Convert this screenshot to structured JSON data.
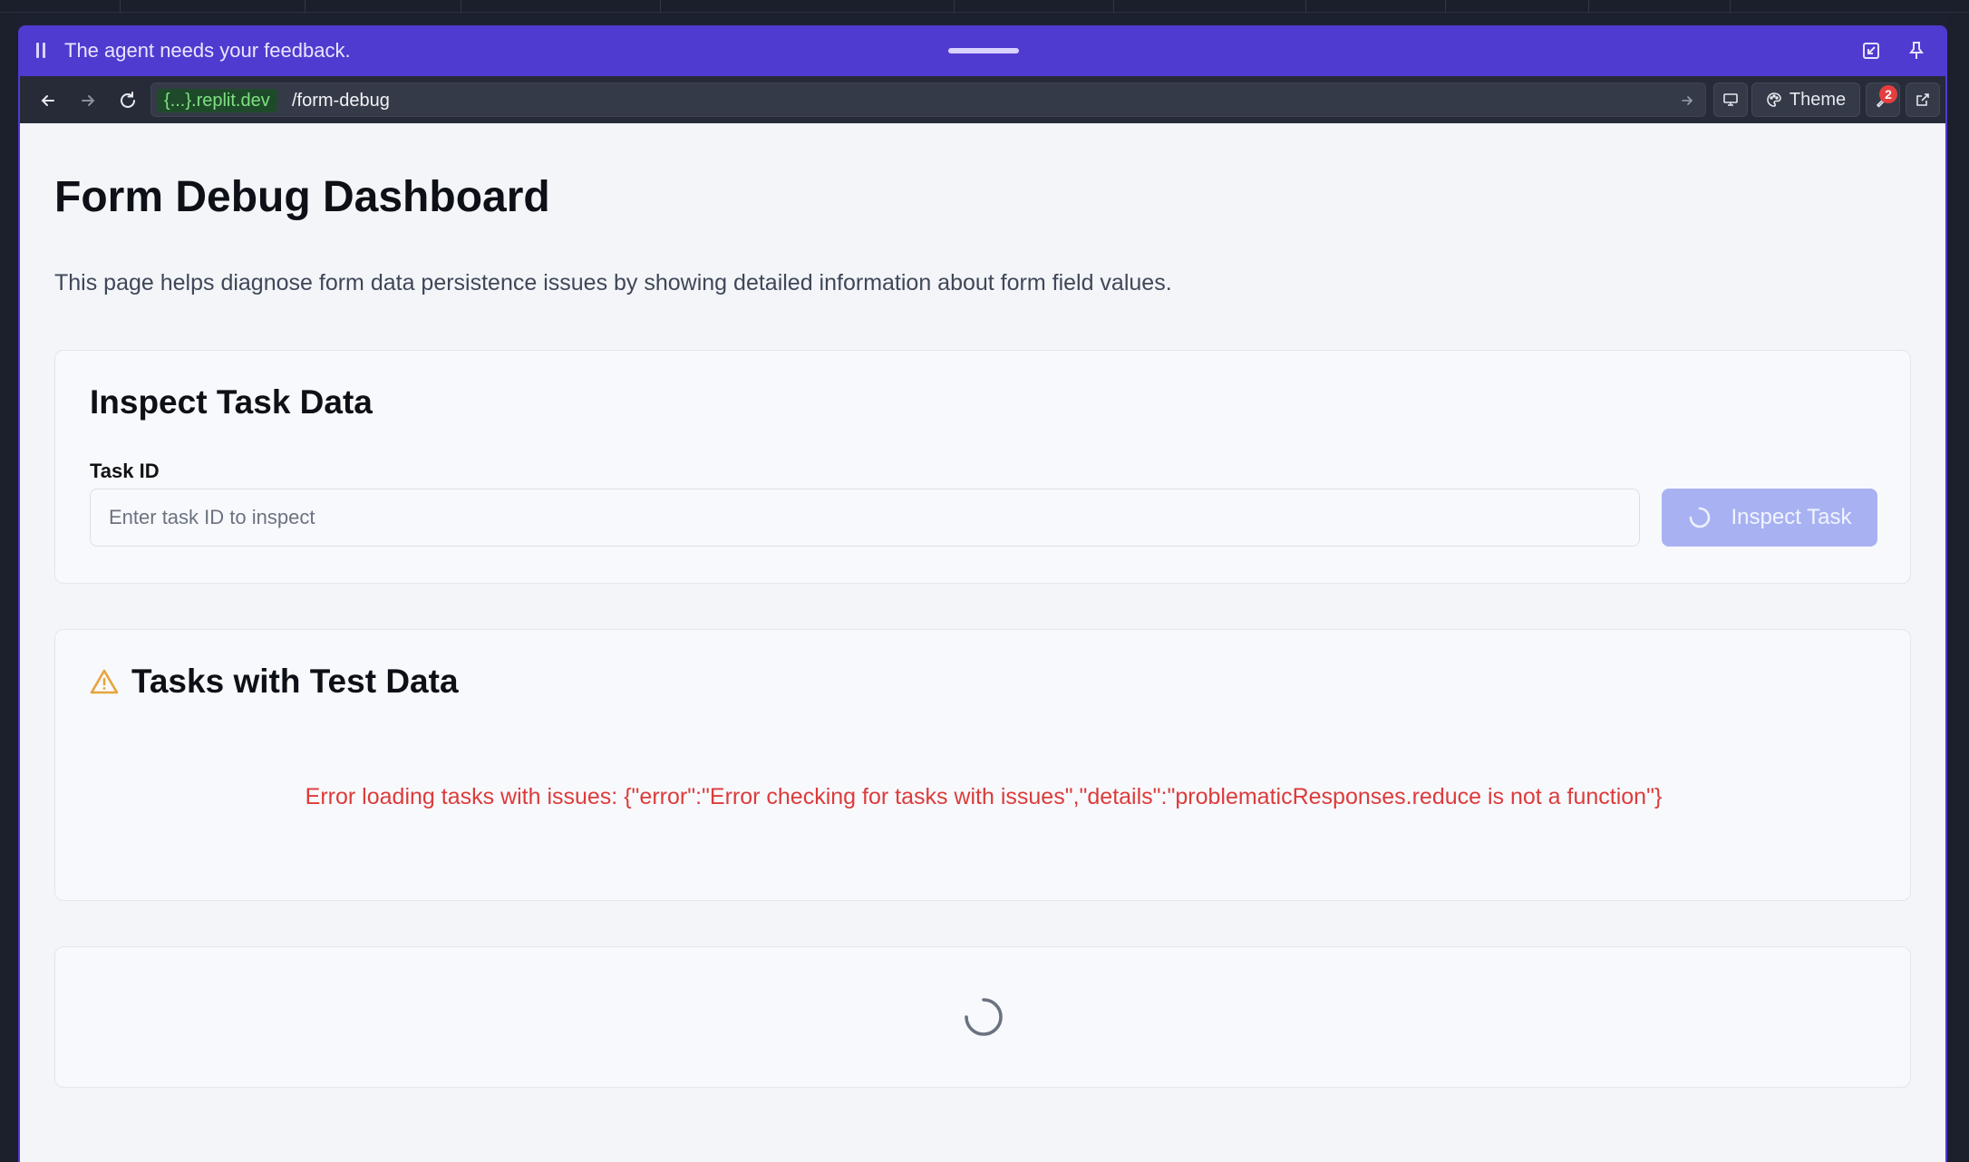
{
  "feedback_bar": {
    "message": "The agent needs your feedback."
  },
  "browser": {
    "domain": "{...}.replit.dev",
    "path": "/form-debug",
    "theme_label": "Theme",
    "devtools_badge": "2"
  },
  "page": {
    "title": "Form Debug Dashboard",
    "description": "This page helps diagnose form data persistence issues by showing detailed information about form field values."
  },
  "inspect_card": {
    "title": "Inspect Task Data",
    "field_label": "Task ID",
    "input_placeholder": "Enter task ID to inspect",
    "input_value": "",
    "button_label": "Inspect Task"
  },
  "test_data_card": {
    "title": "Tasks with Test Data",
    "error_message": "Error loading tasks with issues: {\"error\":\"Error checking for tasks with issues\",\"details\":\"problematicResponses.reduce is not a function\"}"
  },
  "colors": {
    "frame_accent": "#4f3bd0",
    "error": "#dc3b3b",
    "warning": "#e8a33a",
    "button_disabled": "#a8b2f2",
    "domain_text": "#7ee082"
  }
}
